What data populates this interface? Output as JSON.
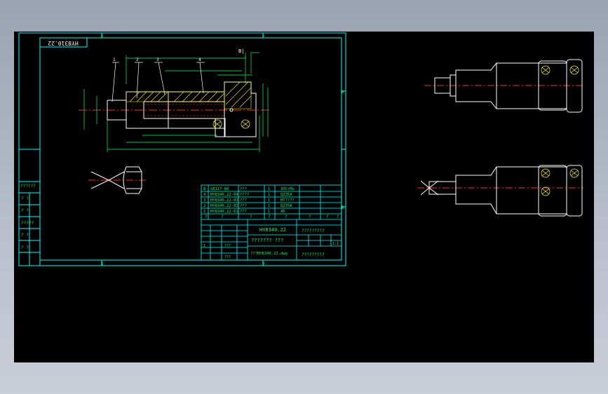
{
  "colors": {
    "frame": "#00ffff",
    "text": "#00ff66",
    "outline": "#ffffff",
    "center_line": "#ff2a2a",
    "hatch": "#ffff00",
    "background": "#000000"
  },
  "drawing": {
    "code_tab": "HY8310.22",
    "zone_top_left": "1",
    "zone_top_right": "2",
    "zone_bottom_left": "1",
    "zone_bottom_right": "2",
    "zone_right": "A",
    "zone_right_b": "B",
    "section_label": "B|",
    "part_callouts": [
      "1",
      "2",
      "3",
      "4"
    ]
  },
  "left_stamp": {
    "rows": [
      "??????",
      "?  ?",
      "?  ?",
      "?????",
      "?  ?",
      "?  ?"
    ]
  },
  "bom": {
    "rows": [
      {
        "no": "B",
        "code": "GB117-86",
        "name": "???",
        "qty": "1",
        "material": "35CrMo"
      },
      {
        "no": "4",
        "code": "HY8340.22-04",
        "name": "????",
        "qty": "1",
        "material": "Q235A"
      },
      {
        "no": "3",
        "code": "HY8340.22-03",
        "name": "???",
        "qty": "1",
        "material": "HT????"
      },
      {
        "no": "2",
        "code": "HY8340.22-02",
        "name": "???",
        "qty": "1",
        "material": "Q235A"
      },
      {
        "no": "1",
        "code": "HY8340.22-01",
        "name": "???",
        "qty": "1",
        "material": "45"
      }
    ],
    "header": [
      "?",
      "?",
      "?",
      "?",
      "?",
      "?",
      "?",
      "?"
    ]
  },
  "title_block": {
    "drawing_no": "HY8340.22",
    "title": "??????? ???",
    "company": "?????????",
    "file": "???HY8340.22.dwg",
    "sign": "?????????",
    "scale": "1:1",
    "sheet": "1",
    "designer": "???",
    "checker": "???"
  }
}
